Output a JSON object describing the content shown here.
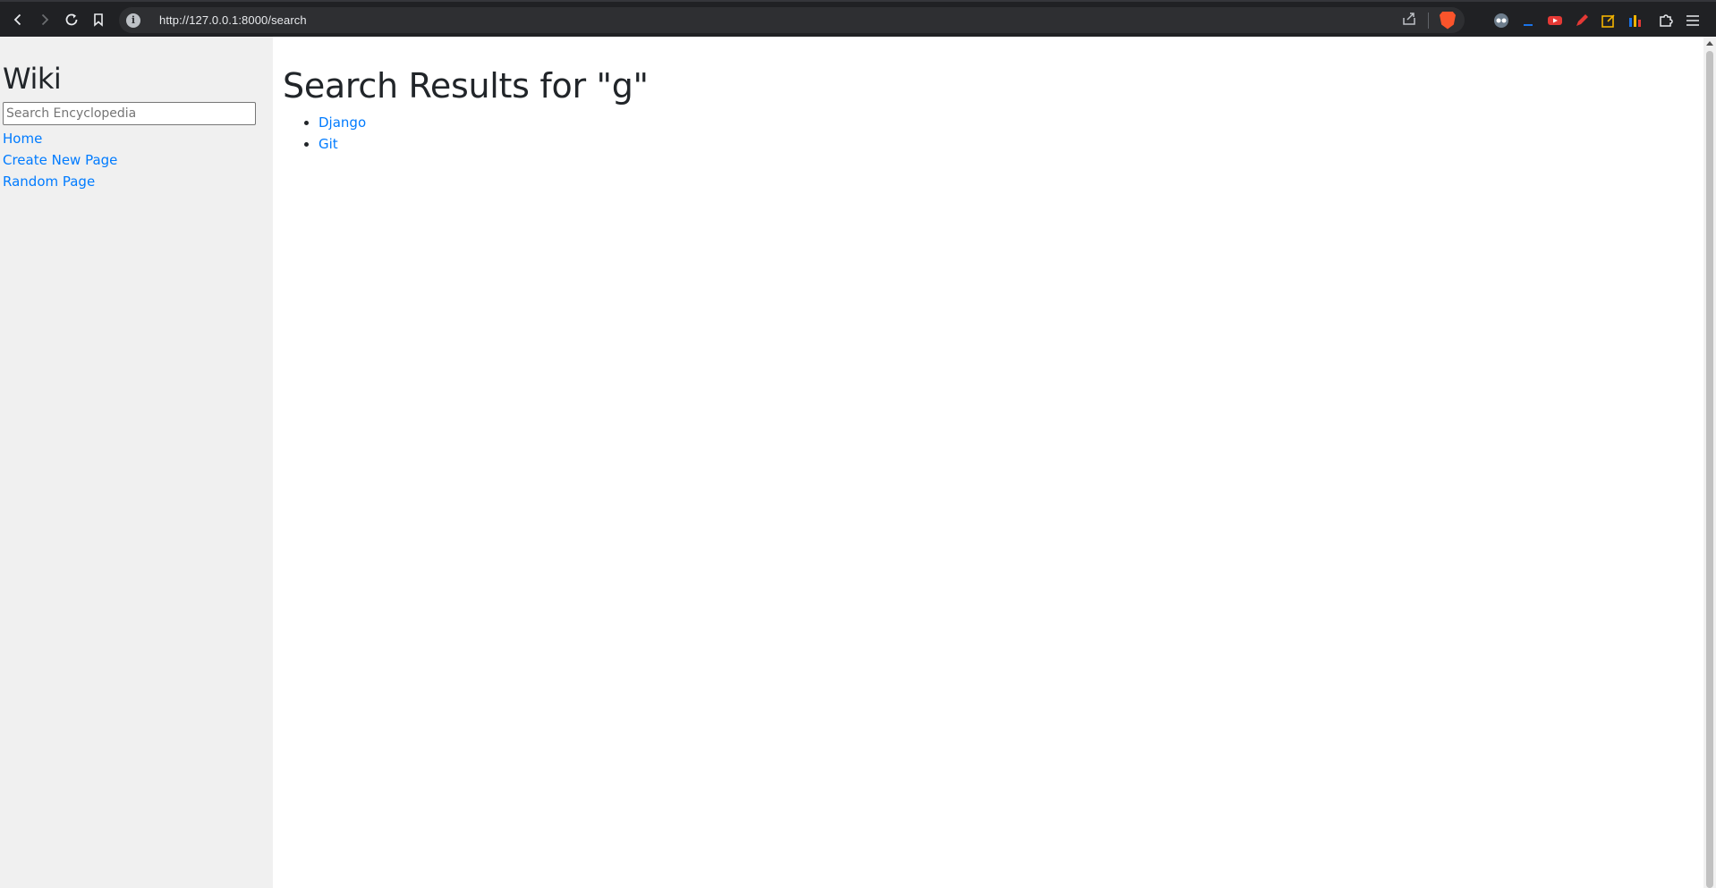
{
  "browser": {
    "url": "http://127.0.0.1:8000/search",
    "icons": {
      "back": "back-arrow-icon",
      "forward": "forward-arrow-icon",
      "reload": "reload-icon",
      "bookmark": "bookmark-icon",
      "site_info": "info-icon",
      "share": "share-icon",
      "brave": "brave-shield-icon",
      "menu": "hamburger-menu-icon"
    }
  },
  "sidebar": {
    "title": "Wiki",
    "search_placeholder": "Search Encyclopedia",
    "links": [
      {
        "label": "Home"
      },
      {
        "label": "Create New Page"
      },
      {
        "label": "Random Page"
      }
    ]
  },
  "main": {
    "heading": "Search Results for \"g\"",
    "results": [
      {
        "label": "Django"
      },
      {
        "label": "Git"
      }
    ]
  },
  "colors": {
    "link": "#007bff",
    "sidebar_bg": "#f0f0f0",
    "text": "#212529",
    "browser_bar": "#202124"
  }
}
